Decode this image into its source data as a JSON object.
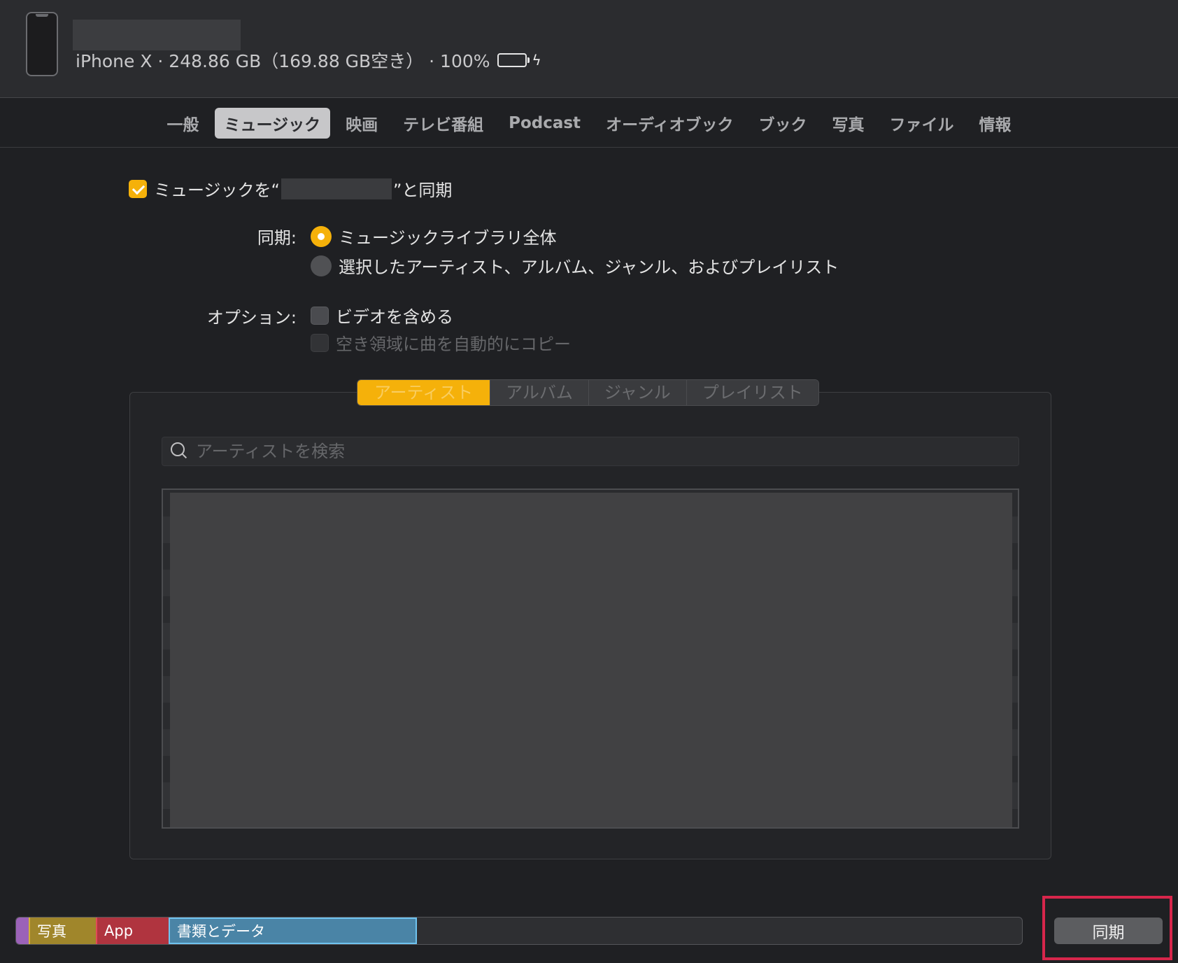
{
  "header": {
    "device_info": "iPhone X · 248.86 GB（169.88 GB空き） · 100%",
    "battery_percent": 100,
    "battery_color": "#2ed31f"
  },
  "tabs": [
    {
      "label": "一般"
    },
    {
      "label": "ミュージック",
      "active": true
    },
    {
      "label": "映画"
    },
    {
      "label": "テレビ番組"
    },
    {
      "label": "Podcast"
    },
    {
      "label": "オーディオブック"
    },
    {
      "label": "ブック"
    },
    {
      "label": "写真"
    },
    {
      "label": "ファイル"
    },
    {
      "label": "情報"
    }
  ],
  "sync_music": {
    "prefix": "ミュージックを“",
    "suffix": "”と同期",
    "checked": true
  },
  "sync_options": {
    "label": "同期:",
    "entire_library": "ミュージックライブラリ全体",
    "selected_items": "選択したアーティスト、アルバム、ジャンル、およびプレイリスト"
  },
  "options": {
    "label": "オプション:",
    "include_video": "ビデオを含める",
    "autofill": "空き領域に曲を自動的にコピー"
  },
  "segments": [
    "アーティスト",
    "アルバム",
    "ジャンル",
    "プレイリスト"
  ],
  "search": {
    "placeholder": "アーティストを検索"
  },
  "storage": {
    "photos": "写真",
    "app": "App",
    "docs": "書類とデータ"
  },
  "sync_button": "同期",
  "colors": {
    "accent": "#f5b10a",
    "highlight": "#d7264b"
  }
}
